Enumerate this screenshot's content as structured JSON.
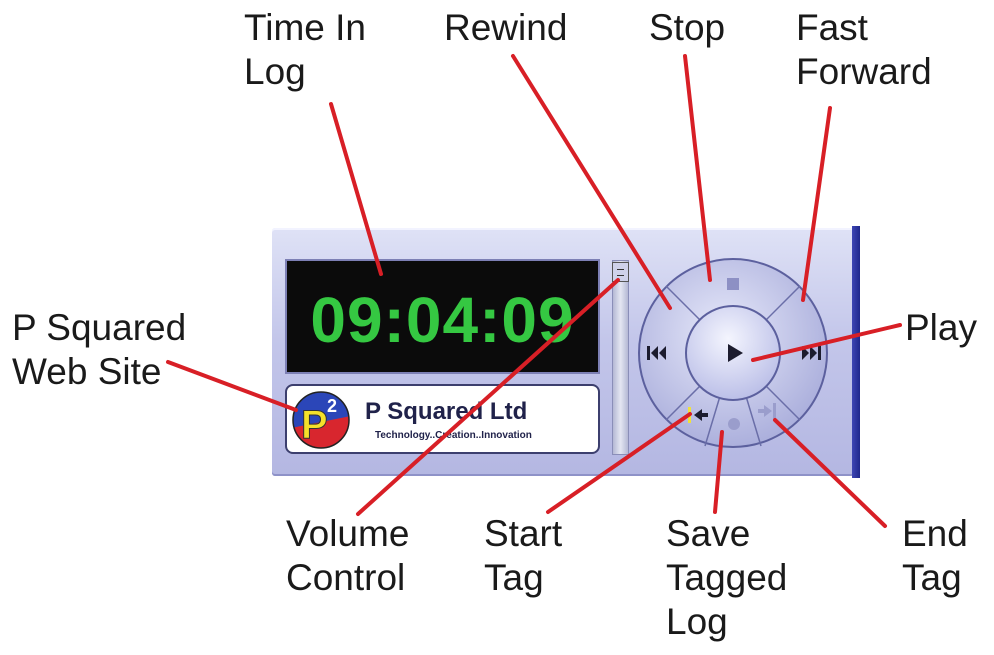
{
  "display": {
    "time": "09:04:09"
  },
  "logo": {
    "name": "P Squared Ltd",
    "tagline": "Technology..Creation..Innovation",
    "monogram": "P",
    "superscript": "2"
  },
  "colors": {
    "time_green": "#35c842",
    "panel": "#c3c6ea",
    "callout_line": "#d81f26",
    "panel_edge": "#2a32a0"
  },
  "callouts": {
    "time_in_log": [
      "Time In",
      "Log"
    ],
    "rewind": [
      "Rewind"
    ],
    "stop": [
      "Stop"
    ],
    "fast_forward": [
      "Fast",
      "Forward"
    ],
    "play": [
      "Play"
    ],
    "web_site": [
      "P Squared",
      "Web Site"
    ],
    "volume": [
      "Volume",
      "Control"
    ],
    "start_tag": [
      "Start",
      "Tag"
    ],
    "save_tagged_log": [
      "Save",
      "Tagged",
      "Log"
    ],
    "end_tag": [
      "End",
      "Tag"
    ]
  },
  "icons": [
    "stop-icon",
    "rewind-icon",
    "play-icon",
    "fast-forward-icon",
    "start-tag-icon",
    "save-tag-icon",
    "end-tag-icon",
    "volume-thumb-icon"
  ]
}
